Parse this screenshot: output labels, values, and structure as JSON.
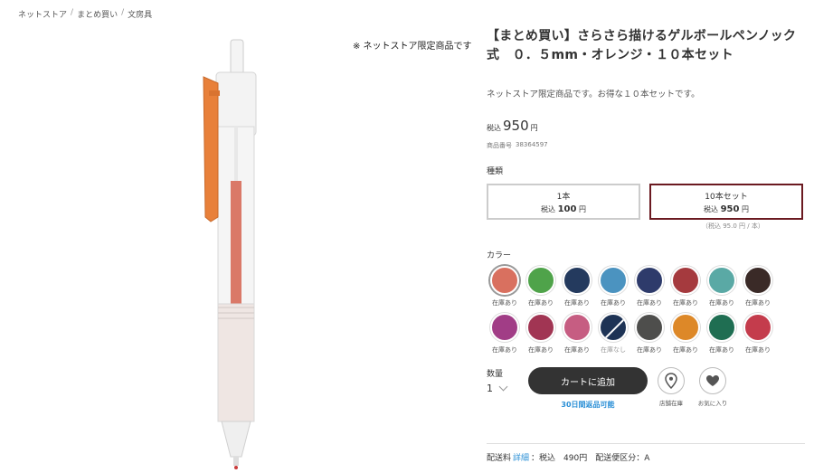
{
  "breadcrumb": [
    "ネットストア",
    "まとめ買い",
    "文房具"
  ],
  "notice": "※ ネットストア限定商品です",
  "product": {
    "title": "【まとめ買い】さらさら描けるゲルボールペンノック式　０．５mm・オレンジ・１０本セット",
    "description": "ネットストア限定商品です。お得な１０本セットです。",
    "price_tax_label": "税込",
    "price_amount": "950",
    "price_yen": "円",
    "sku_label": "商品番号",
    "sku": "38364597"
  },
  "variants": {
    "label": "種類",
    "items": [
      {
        "name": "1本",
        "tax": "税込",
        "price": "100",
        "yen": "円"
      },
      {
        "name": "10本セット",
        "tax": "税込",
        "price": "950",
        "yen": "円"
      }
    ],
    "unit_price": "（税込 95.0 円 / 本）",
    "selected_index": 1
  },
  "colors": {
    "label": "カラー",
    "selected_index": 0,
    "items": [
      {
        "hex": "#d9705f",
        "stock": "在庫あり",
        "available": true
      },
      {
        "hex": "#4fa34a",
        "stock": "在庫あり",
        "available": true
      },
      {
        "hex": "#243a5e",
        "stock": "在庫あり",
        "available": true
      },
      {
        "hex": "#4b93c0",
        "stock": "在庫あり",
        "available": true
      },
      {
        "hex": "#2e3b6b",
        "stock": "在庫あり",
        "available": true
      },
      {
        "hex": "#a53a3e",
        "stock": "在庫あり",
        "available": true
      },
      {
        "hex": "#5aa9a5",
        "stock": "在庫あり",
        "available": true
      },
      {
        "hex": "#3a2a27",
        "stock": "在庫あり",
        "available": true
      },
      {
        "hex": "#a13d86",
        "stock": "在庫あり",
        "available": true
      },
      {
        "hex": "#a13553",
        "stock": "在庫あり",
        "available": true
      },
      {
        "hex": "#c65d82",
        "stock": "在庫あり",
        "available": true
      },
      {
        "hex": "#1e3355",
        "stock": "在庫なし",
        "available": false
      },
      {
        "hex": "#4e4e4c",
        "stock": "在庫あり",
        "available": true
      },
      {
        "hex": "#dd8828",
        "stock": "在庫あり",
        "available": true
      },
      {
        "hex": "#1f6e52",
        "stock": "在庫あり",
        "available": true
      },
      {
        "hex": "#c43c4c",
        "stock": "在庫あり",
        "available": true
      }
    ]
  },
  "purchase": {
    "qty_label": "数量",
    "qty_value": "1",
    "cart_label": "カートに追加",
    "returns_label": "30日間返品可能",
    "store_stock_label": "店舗在庫",
    "favorite_label": "お気に入り"
  },
  "shipping": {
    "label": "配送料",
    "detail_link": "詳細",
    "text": "：税込　490円　配送便区分：A"
  }
}
